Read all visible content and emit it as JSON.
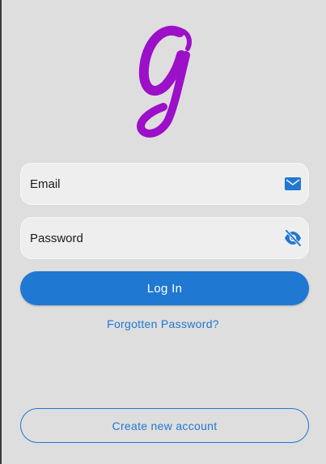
{
  "app": {
    "logo_icon": "script-g-logo-icon",
    "brand_color": "#9b10c8"
  },
  "login_form": {
    "email": {
      "placeholder": "Email",
      "value": "",
      "icon": "email-icon"
    },
    "password": {
      "placeholder": "Password",
      "value": "",
      "icon": "visibility-off-icon"
    },
    "login_label": "Log In",
    "forgot_label": "Forgotten Password?",
    "create_account_label": "Create new account"
  },
  "colors": {
    "accent": "#1f78d1",
    "background": "#dedede",
    "field_background": "#eeeeee"
  }
}
